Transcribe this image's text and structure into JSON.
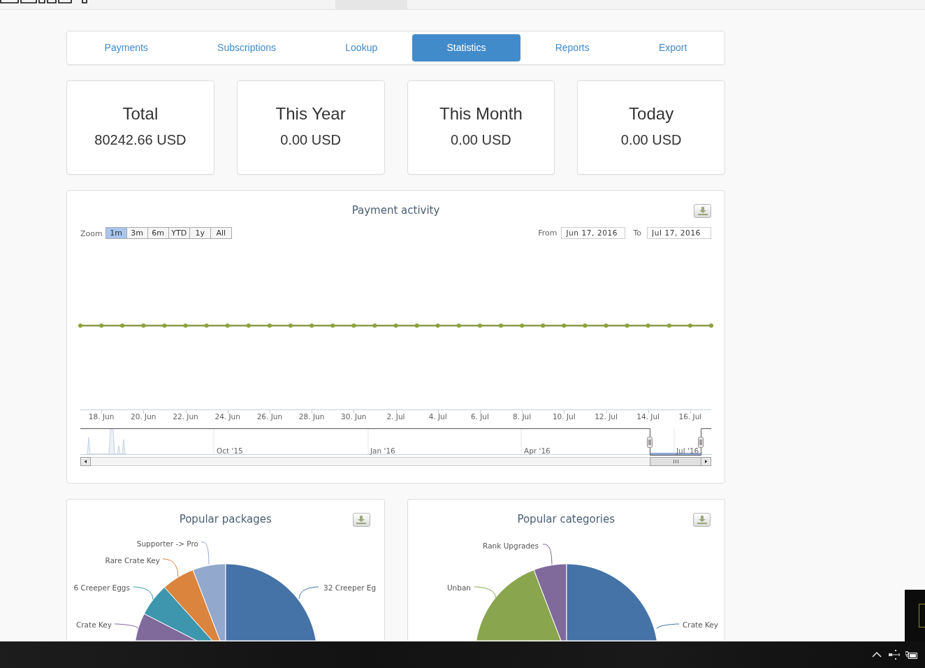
{
  "nav": {
    "tabs": [
      {
        "label": "Payments",
        "selected": false
      },
      {
        "label": "Subscriptions",
        "selected": false
      },
      {
        "label": "Lookup",
        "selected": false
      },
      {
        "label": "Statistics",
        "selected": true
      },
      {
        "label": "Reports",
        "selected": false
      },
      {
        "label": "Export",
        "selected": false
      }
    ]
  },
  "stats": [
    {
      "title": "Total",
      "value": "80242.66 USD"
    },
    {
      "title": "This Year",
      "value": "0.00 USD"
    },
    {
      "title": "This Month",
      "value": "0.00 USD"
    },
    {
      "title": "Today",
      "value": "0.00 USD"
    }
  ],
  "activity_chart": {
    "title": "Payment activity",
    "zoom_label": "Zoom",
    "zoom_buttons": [
      {
        "label": "1m",
        "selected": true
      },
      {
        "label": "3m",
        "selected": false
      },
      {
        "label": "6m",
        "selected": false
      },
      {
        "label": "YTD",
        "selected": false
      },
      {
        "label": "1y",
        "selected": false
      },
      {
        "label": "All",
        "selected": false
      }
    ],
    "from_label": "From",
    "from_date": "Jun 17, 2016",
    "to_label": "To",
    "to_date": "Jul 17, 2016",
    "x_axis_labels": [
      "18. Jun",
      "20. Jun",
      "22. Jun",
      "24. Jun",
      "26. Jun",
      "28. Jun",
      "30. Jun",
      "2. Jul",
      "4. Jul",
      "6. Jul",
      "8. Jul",
      "10. Jul",
      "12. Jul",
      "14. Jul",
      "16. Jul"
    ],
    "navigator_labels": [
      "Oct '15",
      "Jan '16",
      "Apr '16",
      "Jul '16"
    ]
  },
  "pies": [
    {
      "title": "Popular packages",
      "slices": [
        {
          "label": "Supporter -> Pro",
          "color": "#92a8cd"
        },
        {
          "label": "Rare Crate Key",
          "color": "#db843d"
        },
        {
          "label": "6 Creeper Eggs",
          "color": "#3d96ae"
        },
        {
          "label": "32 Creeper Eg",
          "color": "#4572a7"
        },
        {
          "label": "Crate Key",
          "color": "#80699b"
        }
      ]
    },
    {
      "title": "Popular categories",
      "slices": [
        {
          "label": "Rank Upgrades",
          "color": "#80699b"
        },
        {
          "label": "Unban",
          "color": "#89a54e"
        },
        {
          "label": "Crate Key",
          "color": "#4572a7"
        }
      ]
    }
  ]
}
